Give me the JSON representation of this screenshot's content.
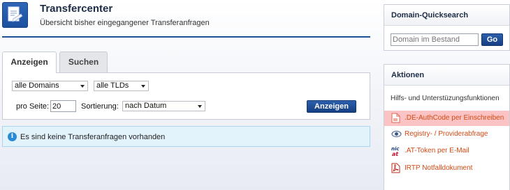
{
  "header": {
    "title": "Transfercenter",
    "subtitle": "Übersicht bisher eingegangener Transferanfragen"
  },
  "tabs": [
    {
      "label": "Anzeigen",
      "active": true
    },
    {
      "label": "Suchen",
      "active": false
    }
  ],
  "filters": {
    "domain_select": "alle Domains",
    "tld_select": "alle TLDs",
    "per_page_label": "pro Seite:",
    "per_page_value": "20",
    "sort_label": "Sortierung:",
    "sort_select": "nach Datum",
    "submit_label": "Anzeigen"
  },
  "info": {
    "message": "Es sind keine Transferanfragen vorhanden"
  },
  "quicksearch": {
    "title": "Domain-Quicksearch",
    "placeholder": "Domain im Bestand",
    "go_label": "Go"
  },
  "actions": {
    "title": "Aktionen",
    "subtitle": "Hilfs- und Unterstüzungsfunktionen",
    "items": [
      {
        "label": ".DE-AuthCode per Einschreiben",
        "icon": "document-icon",
        "highlighted": true
      },
      {
        "label": "Registry- / Providerabfrage",
        "icon": "eye-icon",
        "highlighted": false
      },
      {
        "label": ".AT-Token per E-Mail",
        "icon": "nic-at-icon",
        "highlighted": false
      },
      {
        "label": "IRTP Notfalldokument",
        "icon": "pdf-icon",
        "highlighted": false
      }
    ]
  },
  "colors": {
    "accent": "#1f4f97",
    "link": "#d04a14",
    "highlight": "#fbc3c3",
    "info_bg": "#e3f3fc"
  }
}
